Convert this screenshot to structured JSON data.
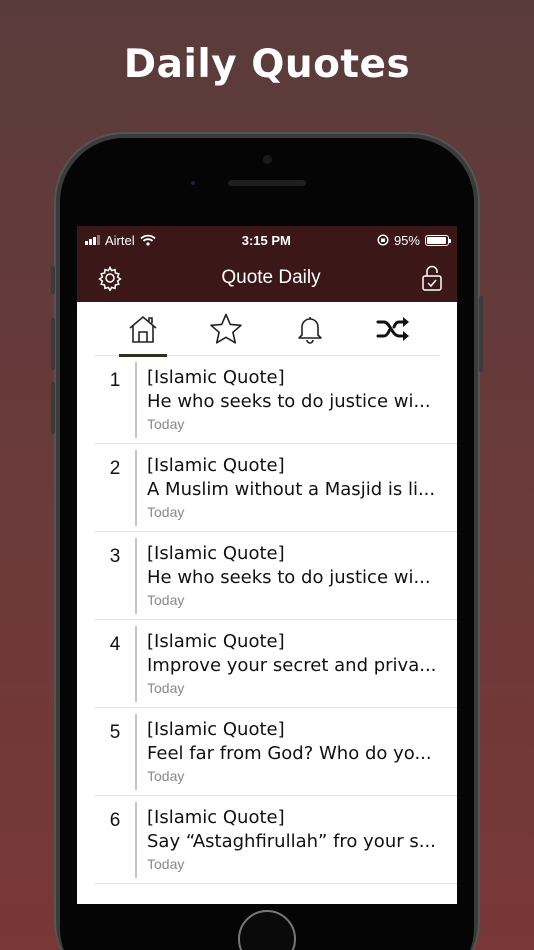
{
  "headline": "Daily Quotes",
  "status_bar": {
    "carrier": "Airtel",
    "time": "3:15 PM",
    "battery": "95%",
    "battery_level": 0.95
  },
  "navbar": {
    "title": "Quote Daily",
    "left_icon": "gear-icon",
    "right_icon": "unlock-icon"
  },
  "tabs": [
    {
      "icon": "home-icon",
      "active": true
    },
    {
      "icon": "star-icon",
      "active": false
    },
    {
      "icon": "bell-icon",
      "active": false
    },
    {
      "icon": "shuffle-icon",
      "active": false
    }
  ],
  "quotes": [
    {
      "num": "1",
      "category": "[Islamic Quote]",
      "text": "He who seeks to do justice wi...",
      "time": "Today"
    },
    {
      "num": "2",
      "category": "[Islamic Quote]",
      "text": "A Muslim without a Masjid is li...",
      "time": "Today"
    },
    {
      "num": "3",
      "category": "[Islamic Quote]",
      "text": "He who seeks to do justice wi...",
      "time": "Today"
    },
    {
      "num": "4",
      "category": "[Islamic Quote]",
      "text": "Improve your secret and priva...",
      "time": "Today"
    },
    {
      "num": "5",
      "category": "[Islamic Quote]",
      "text": "Feel far from God? Who do yo...",
      "time": "Today"
    },
    {
      "num": "6",
      "category": "[Islamic Quote]",
      "text": "Say “Astaghfirullah” fro your s...",
      "time": "Today"
    }
  ],
  "colors": {
    "background_top": "#5a3b3b",
    "background_bottom": "#793737",
    "navbar": "#3b1717",
    "tab_indicator": "#2f2f1c"
  }
}
